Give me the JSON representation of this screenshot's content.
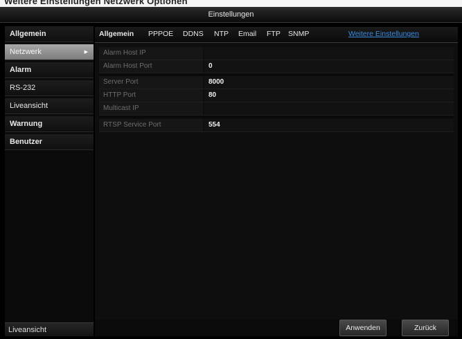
{
  "top_caption": "Weitere Einstellungen Netzwerk Optionen",
  "window": {
    "title": "Einstellungen"
  },
  "sidebar": {
    "items": [
      {
        "label": "Allgemein"
      },
      {
        "label": "Netzwerk",
        "active": true
      },
      {
        "label": "Alarm"
      },
      {
        "label": "RS-232"
      },
      {
        "label": "Liveansicht"
      },
      {
        "label": "Warnung"
      },
      {
        "label": "Benutzer"
      }
    ],
    "bottom_label": "Liveansicht"
  },
  "tabs": [
    {
      "label": "Allgemein"
    },
    {
      "label": "PPPOE"
    },
    {
      "label": "DDNS"
    },
    {
      "label": "NTP"
    },
    {
      "label": "Email"
    },
    {
      "label": "FTP"
    },
    {
      "label": "SNMP"
    },
    {
      "label": "Weitere Einstellungen",
      "active": true
    }
  ],
  "form": {
    "rows": [
      {
        "label": "Alarm Host IP",
        "value": ""
      },
      {
        "label": "Alarm Host Port",
        "value": "0"
      },
      {
        "label": "Server Port",
        "value": "8000"
      },
      {
        "label": "HTTP Port",
        "value": "80"
      },
      {
        "label": "Multicast IP",
        "value": ""
      },
      {
        "label": "RTSP Service Port",
        "value": "554"
      }
    ]
  },
  "buttons": {
    "apply_label": "Anwenden",
    "back_label": "Zurück"
  },
  "colors": {
    "background": "#000000",
    "active_tab": "#3b8ee6",
    "active_sidebar": "#8c8c8c"
  }
}
